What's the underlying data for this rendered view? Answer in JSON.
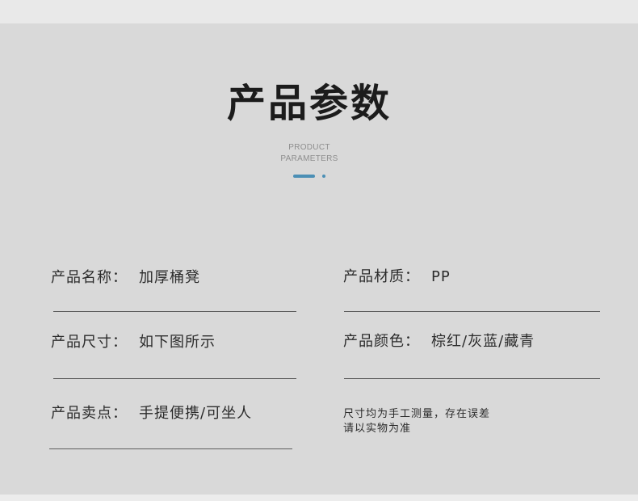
{
  "header": {
    "title": "产品参数",
    "subtitle_line1": "PRODUCT",
    "subtitle_line2": "PARAMETERS"
  },
  "params": {
    "name": {
      "label": "产品名称：",
      "value": "加厚桶凳"
    },
    "material": {
      "label": "产品材质：",
      "value": "PP"
    },
    "size": {
      "label": "产品尺寸：",
      "value": "如下图所示"
    },
    "color": {
      "label": "产品颜色：",
      "value": "棕红/灰蓝/藏青"
    },
    "selling_point": {
      "label": "产品卖点：",
      "value": "手提便携/可坐人"
    }
  },
  "note": {
    "line1": "尺寸均为手工测量，存在误差",
    "line2": "请以实物为准"
  },
  "colors": {
    "accent": "#4b8fb5",
    "panel_bg": "#d9d9d9",
    "text": "#2b2b2b"
  }
}
